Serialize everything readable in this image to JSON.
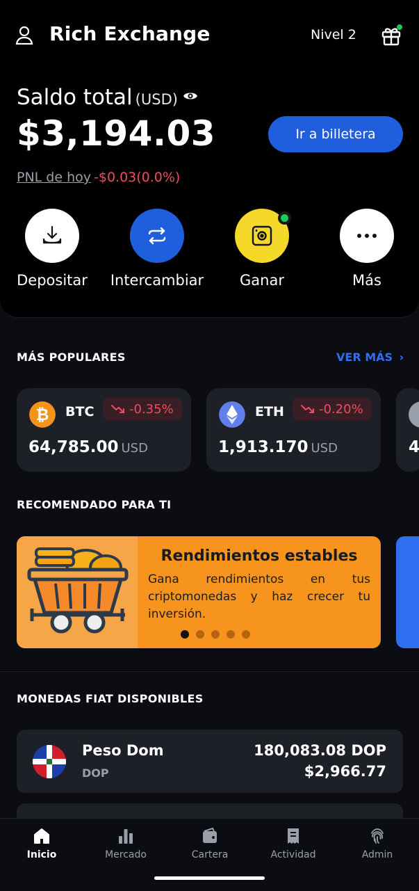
{
  "header": {
    "title": "Rich Exchange",
    "level": "Nivel 2"
  },
  "balance": {
    "label": "Saldo total",
    "currency": "(USD)",
    "amount": "$3,194.03",
    "wallet_button": "Ir a billetera",
    "pnl_label": "PNL de hoy",
    "pnl_value": "-$0.03(0.0%)"
  },
  "actions": [
    {
      "label": "Depositar",
      "icon": "deposit-icon",
      "color": "#ffffff"
    },
    {
      "label": "Intercambiar",
      "icon": "swap-icon",
      "color": "#1f5fde"
    },
    {
      "label": "Ganar",
      "icon": "earn-icon",
      "color": "#f5d92a"
    },
    {
      "label": "Más",
      "icon": "more-icon",
      "color": "#ffffff"
    }
  ],
  "popular": {
    "title": "MÁS POPULARES",
    "see_more": "VER MÁS",
    "coins": [
      {
        "symbol": "BTC",
        "change": "-0.35%",
        "price": "64,785.00",
        "unit": "USD",
        "color": "#f7931a"
      },
      {
        "symbol": "ETH",
        "change": "-0.20%",
        "price": "1,913.170",
        "unit": "USD",
        "color": "#627eea"
      }
    ],
    "partial_price": "4"
  },
  "recommended": {
    "title": "RECOMENDADO PARA TI",
    "promo_title": "Rendimientos estables",
    "promo_text": "Gana rendimientos en tus criptomonedas y haz crecer tu inversión.",
    "active_dot": 0,
    "dot_count": 5
  },
  "fiat": {
    "title": "MONEDAS FIAT DISPONIBLES",
    "items": [
      {
        "name": "Peso Dom",
        "code": "DOP",
        "amount": "180,083.08 DOP",
        "usd": "$2,966.77"
      }
    ]
  },
  "nav": [
    {
      "label": "Inicio",
      "icon": "home-icon",
      "active": true
    },
    {
      "label": "Mercado",
      "icon": "bar-chart-icon",
      "active": false
    },
    {
      "label": "Cartera",
      "icon": "wallet-icon",
      "active": false
    },
    {
      "label": "Actividad",
      "icon": "receipt-icon",
      "active": false
    },
    {
      "label": "Admin",
      "icon": "fingerprint-icon",
      "active": false
    }
  ],
  "colors": {
    "accent": "#1f5fde",
    "negative": "#ef4d5e",
    "positive_dot": "#22c55e"
  }
}
